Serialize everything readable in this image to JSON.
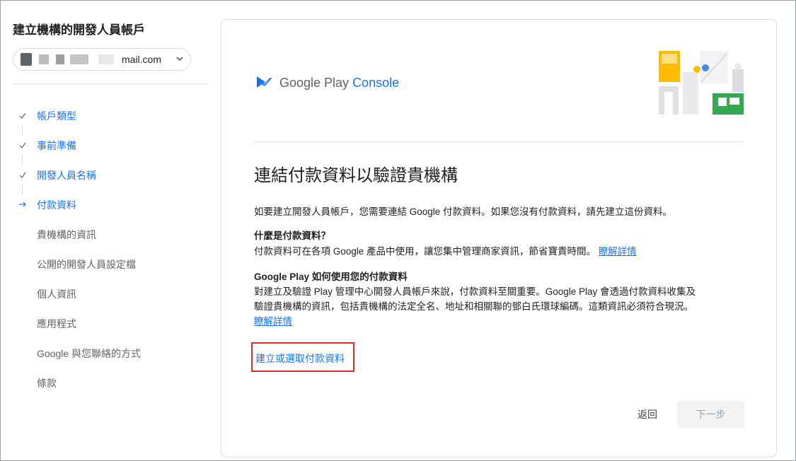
{
  "sidebar": {
    "title": "建立機構的開發人員帳戶",
    "account_email": "mail.com",
    "steps": [
      {
        "label": "帳戶類型",
        "state": "done"
      },
      {
        "label": "事前準備",
        "state": "done"
      },
      {
        "label": "開發人員名稱",
        "state": "done"
      },
      {
        "label": "付款資料",
        "state": "active"
      },
      {
        "label": "貴機構的資訊",
        "state": "todo"
      },
      {
        "label": "公開的開發人員設定檔",
        "state": "todo"
      },
      {
        "label": "個人資訊",
        "state": "todo"
      },
      {
        "label": "應用程式",
        "state": "todo"
      },
      {
        "label": "Google 與您聯絡的方式",
        "state": "todo"
      },
      {
        "label": "條款",
        "state": "todo"
      }
    ]
  },
  "header": {
    "logo_text_main": "Google Play ",
    "logo_text_accent": "Console"
  },
  "main": {
    "heading": "連結付款資料以驗證貴機構",
    "intro": "如要建立開發人員帳戶，您需要連結 Google 付款資料。如果您沒有付款資料，請先建立這份資料。",
    "q1_title": "什麼是付款資料？",
    "q1_body": "付款資料可在各項 Google 產品中使用，讓您集中管理商家資訊，節省寶貴時間。",
    "q1_link": "瞭解詳情",
    "q2_title": "Google Play 如何使用您的付款資料",
    "q2_line1": "對建立及驗證 Play 管理中心開發人員帳戶來說，付款資料至關重要。Google Play 會透過付款資料收集及",
    "q2_line2": "驗證貴機構的資訊，包括貴機構的法定全名、地址和相關聯的鄧白氏環球編碼。這類資訊必須符合現況。",
    "q2_link": "瞭解詳情",
    "cta_label": "建立或選取付款資料"
  },
  "footer": {
    "back_label": "返回",
    "next_label": "下一步"
  },
  "colors": {
    "accent": "#1a73e8",
    "highlight_border": "#d93025",
    "disabled_bg": "#f1f3f4"
  }
}
